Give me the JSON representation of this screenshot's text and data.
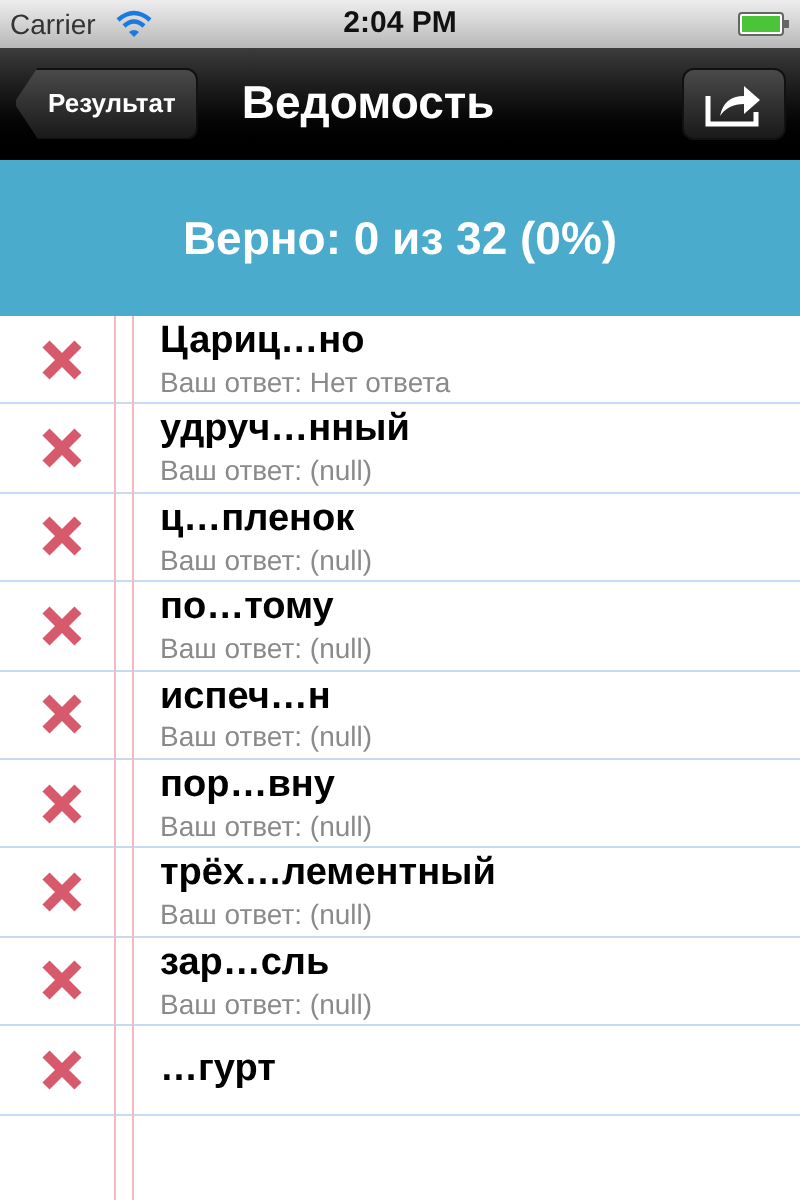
{
  "status_bar": {
    "carrier": "Carrier",
    "time": "2:04 PM"
  },
  "nav_bar": {
    "back": "Результат",
    "title": "Ведомость"
  },
  "summary": "Верно: 0 из 32 (0%)",
  "rows": [
    {
      "word": "Цариц…но",
      "answer": "Ваш ответ: Нет ответа",
      "correct": false
    },
    {
      "word": "удруч…нный",
      "answer": "Ваш ответ: (null)",
      "correct": false
    },
    {
      "word": "ц…пленок",
      "answer": "Ваш ответ: (null)",
      "correct": false
    },
    {
      "word": "по…тому",
      "answer": "Ваш ответ: (null)",
      "correct": false
    },
    {
      "word": "испеч…н",
      "answer": "Ваш ответ: (null)",
      "correct": false
    },
    {
      "word": "пор…вну",
      "answer": "Ваш ответ: (null)",
      "correct": false
    },
    {
      "word": "трёх…лементный",
      "answer": "Ваш ответ: (null)",
      "correct": false
    },
    {
      "word": "зар…сль",
      "answer": "Ваш ответ: (null)",
      "correct": false
    },
    {
      "word": "…гурт",
      "correct": false
    }
  ]
}
